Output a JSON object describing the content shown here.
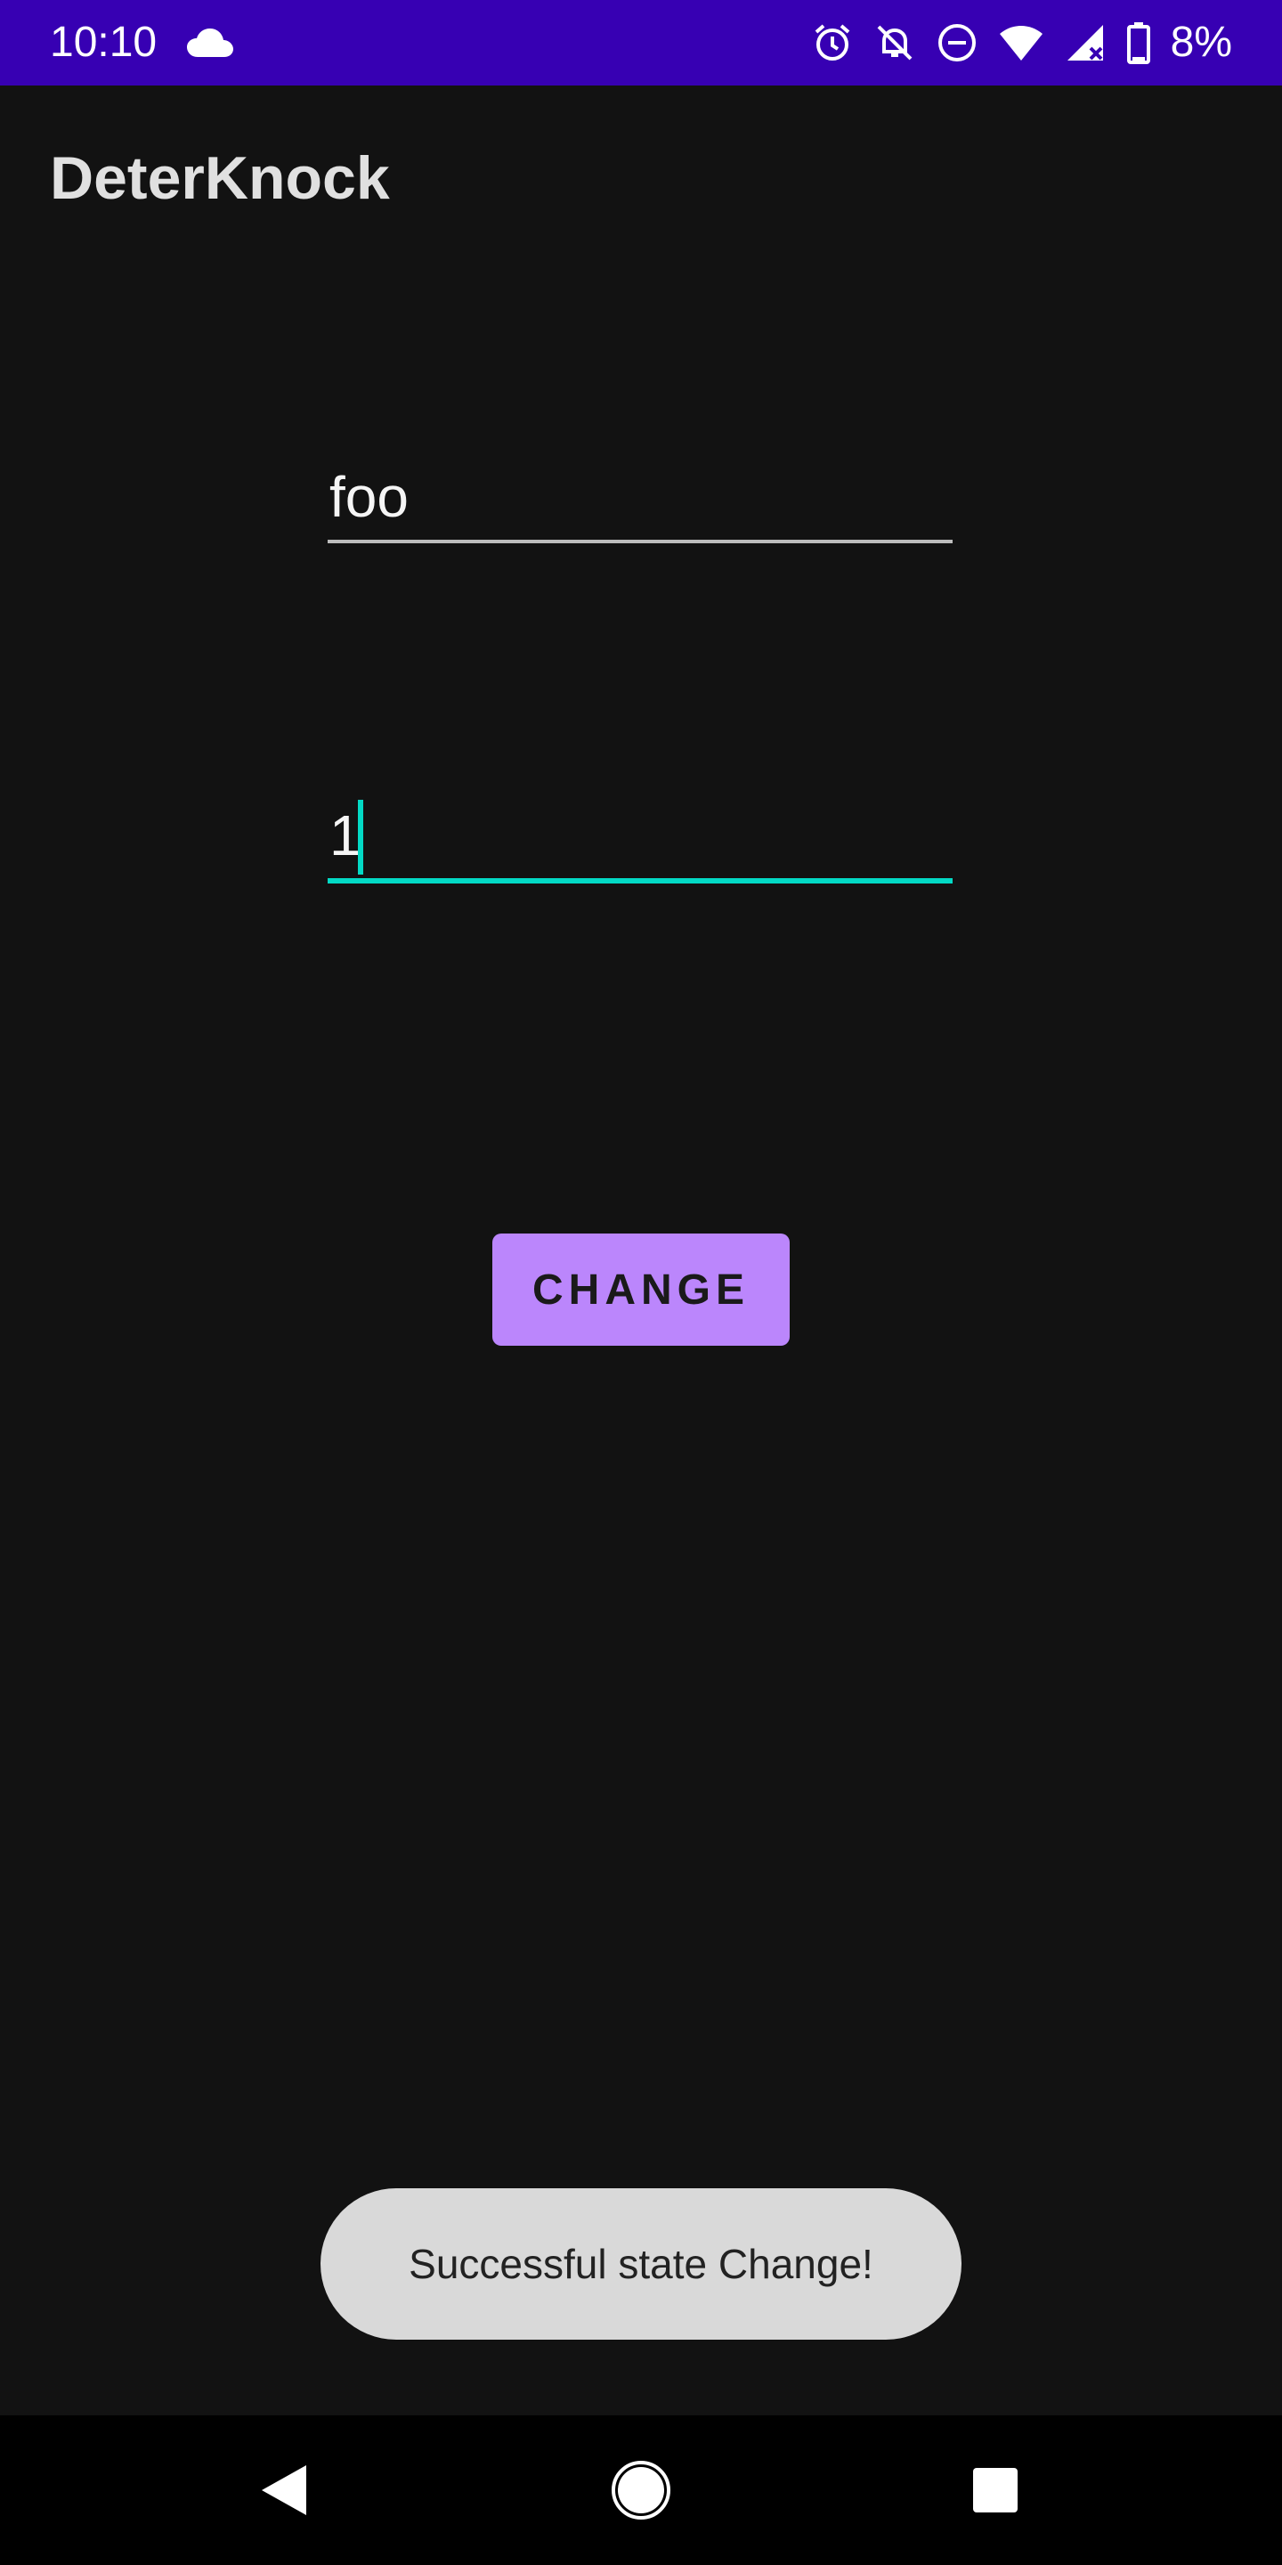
{
  "status_bar": {
    "time": "10:10",
    "battery": "8%",
    "icons": [
      "cloud-icon",
      "alarm-icon",
      "notifications-off-icon",
      "do-not-disturb-icon",
      "wifi-icon",
      "cell-signal-icon",
      "battery-icon"
    ]
  },
  "app": {
    "title": "DeterKnock"
  },
  "form": {
    "field_1_value": "foo",
    "field_2_value": "1",
    "change_button_label": "CHANGE"
  },
  "toast": {
    "message": "Successful state Change!"
  },
  "nav_bar": {
    "icons": [
      "back-icon",
      "home-icon",
      "recents-icon"
    ]
  },
  "colors": {
    "status_bar": "#3700b3",
    "background": "#121212",
    "accent": "#03dac5",
    "button": "#bb86fc",
    "toast": "#d9d9d9"
  }
}
